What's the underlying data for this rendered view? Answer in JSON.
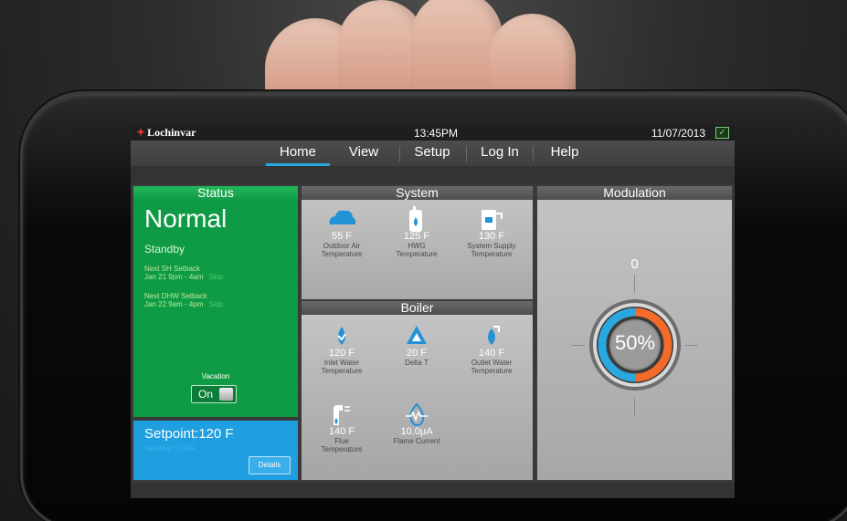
{
  "topbar": {
    "brand": "Lochinvar",
    "time": "13:45PM",
    "date": "11/07/2013"
  },
  "nav": {
    "items": [
      {
        "label": "Home",
        "active": true
      },
      {
        "label": "View",
        "active": false
      },
      {
        "label": "Setup",
        "active": false
      },
      {
        "label": "Log In",
        "active": false
      },
      {
        "label": "Help",
        "active": false
      }
    ]
  },
  "status": {
    "header": "Status",
    "state": "Normal",
    "substate": "Standby",
    "sh_setback_title": "Next SH Setback",
    "sh_setback_time": "Jan 21 9pm - 4am",
    "dhw_setback_title": "Next DHW Setback",
    "dhw_setback_time": "Jan 22 9am - 4pm",
    "skip_label": "Skip",
    "vacation_label": "Vacation",
    "vacation_state": "On"
  },
  "setpoint": {
    "title": "Setpoint:120 F",
    "subtitle": "Setpoint: DOFF",
    "details_label": "Details"
  },
  "system": {
    "header": "System",
    "tiles": [
      {
        "value": "55 F",
        "label1": "Outdoor Air",
        "label2": "Temperature",
        "icon": "cloud-icon"
      },
      {
        "value": "125 F",
        "label1": "HWG",
        "label2": "Temperature",
        "icon": "water-heater-icon"
      },
      {
        "value": "130 F",
        "label1": "System Supply",
        "label2": "Temperature",
        "icon": "supply-icon"
      }
    ]
  },
  "boiler": {
    "header": "Boiler",
    "tiles": [
      {
        "value": "120 F",
        "label1": "Inlet Water",
        "label2": "Temperature",
        "icon": "inlet-water-icon"
      },
      {
        "value": "20 F",
        "label1": "Delta T",
        "label2": "",
        "icon": "delta-icon"
      },
      {
        "value": "140 F",
        "label1": "Outlet Water",
        "label2": "Temperature",
        "icon": "outlet-water-icon"
      },
      {
        "value": "140 F",
        "label1": "Flue",
        "label2": "Temperature",
        "icon": "flue-icon"
      },
      {
        "value": "10.0µA",
        "label1": "Flame Current",
        "label2": "",
        "icon": "flame-icon"
      }
    ]
  },
  "modulation": {
    "header": "Modulation",
    "top_value": "0",
    "percent_text": "50%",
    "percent": 50,
    "color_low": "#29a8e0",
    "color_high": "#f26b2a"
  }
}
